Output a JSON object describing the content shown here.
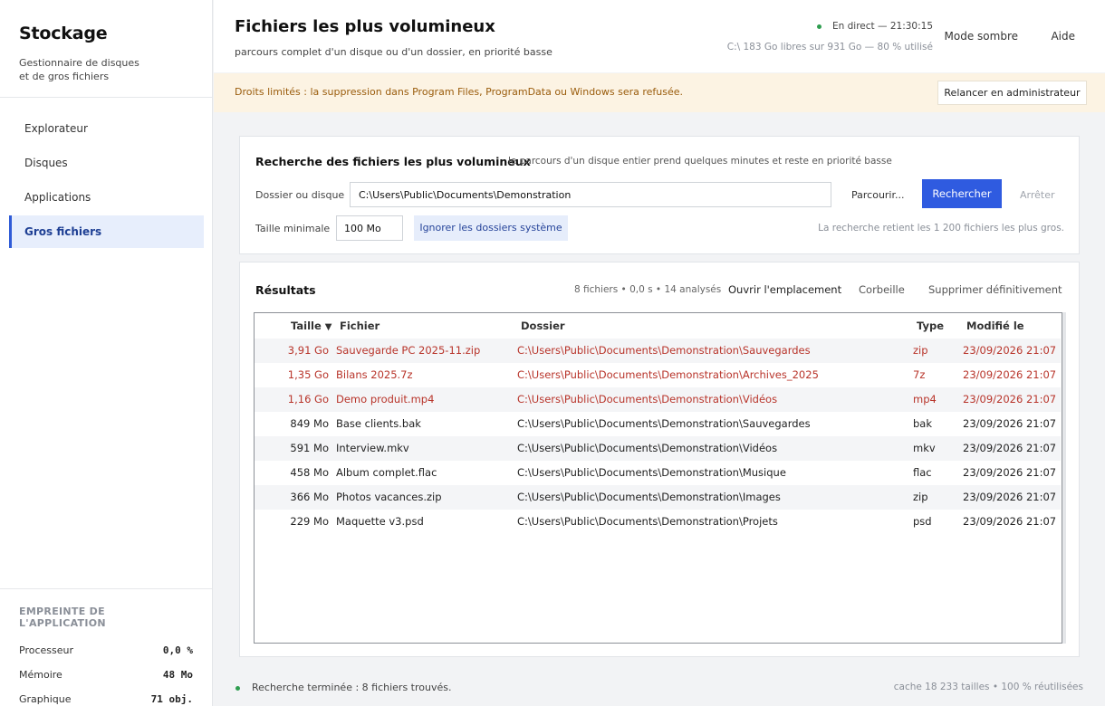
{
  "app": {
    "title": "Stockage",
    "subtitle": "Gestionnaire de disques et de gros fichiers"
  },
  "sidebar": {
    "items": [
      {
        "label": "Explorateur",
        "active": false
      },
      {
        "label": "Disques",
        "active": false
      },
      {
        "label": "Applications",
        "active": false
      },
      {
        "label": "Gros fichiers",
        "active": true
      }
    ],
    "footprint": {
      "title": "EMPREINTE DE L'APPLICATION",
      "rows": [
        {
          "label": "Processeur",
          "value": "0,0 %"
        },
        {
          "label": "Mémoire",
          "value": "48 Mo"
        },
        {
          "label": "Graphique",
          "value": "71 obj."
        }
      ]
    }
  },
  "header": {
    "title": "Fichiers les plus volumineux",
    "subtitle": "parcours complet d'un disque ou d'un dossier, en priorité basse",
    "live": "En direct — 21:30:15",
    "disk_info": "C:\\ 183 Go libres sur 931 Go — 80 % utilisé",
    "dark_mode": "Mode sombre",
    "help": "Aide"
  },
  "banner": {
    "text": "Droits limités : la suppression dans Program Files, ProgramData ou Windows sera refusée.",
    "button": "Relancer en administrateur"
  },
  "search": {
    "title": "Recherche des fichiers les plus volumineux",
    "hint": "le parcours d'un disque entier prend quelques minutes et reste en priorité basse",
    "folder_label": "Dossier ou disque",
    "folder_value": "C:\\Users\\Public\\Documents\\Demonstration",
    "browse": "Parcourir...",
    "search_button": "Rechercher",
    "stop_button": "Arrêter",
    "min_size_label": "Taille minimale",
    "min_size_value": "100 Mo",
    "ignore_system": "Ignorer les dossiers système",
    "limit_note": "La recherche retient les 1 200 fichiers les plus gros."
  },
  "results": {
    "title": "Résultats",
    "stats": "8 fichiers • 0,0 s • 14 analysés",
    "open_location": "Ouvrir l'emplacement",
    "trash": "Corbeille",
    "delete_permanently": "Supprimer définitivement",
    "columns": {
      "size": "Taille",
      "file": "Fichier",
      "folder": "Dossier",
      "type": "Type",
      "modified": "Modifié le"
    },
    "sort_indicator": "▼",
    "highlight_color": "#b8342a",
    "rows": [
      {
        "size": "3,91 Go",
        "file": "Sauvegarde PC 2025-11.zip",
        "folder": "C:\\Users\\Public\\Documents\\Demonstration\\Sauvegardes",
        "type": "zip",
        "modified": "23/09/2026 21:07",
        "highlight": true
      },
      {
        "size": "1,35 Go",
        "file": "Bilans 2025.7z",
        "folder": "C:\\Users\\Public\\Documents\\Demonstration\\Archives_2025",
        "type": "7z",
        "modified": "23/09/2026 21:07",
        "highlight": true
      },
      {
        "size": "1,16 Go",
        "file": "Demo produit.mp4",
        "folder": "C:\\Users\\Public\\Documents\\Demonstration\\Vidéos",
        "type": "mp4",
        "modified": "23/09/2026 21:07",
        "highlight": true
      },
      {
        "size": "849 Mo",
        "file": "Base clients.bak",
        "folder": "C:\\Users\\Public\\Documents\\Demonstration\\Sauvegardes",
        "type": "bak",
        "modified": "23/09/2026 21:07",
        "highlight": false
      },
      {
        "size": "591 Mo",
        "file": "Interview.mkv",
        "folder": "C:\\Users\\Public\\Documents\\Demonstration\\Vidéos",
        "type": "mkv",
        "modified": "23/09/2026 21:07",
        "highlight": false
      },
      {
        "size": "458 Mo",
        "file": "Album complet.flac",
        "folder": "C:\\Users\\Public\\Documents\\Demonstration\\Musique",
        "type": "flac",
        "modified": "23/09/2026 21:07",
        "highlight": false
      },
      {
        "size": "366 Mo",
        "file": "Photos vacances.zip",
        "folder": "C:\\Users\\Public\\Documents\\Demonstration\\Images",
        "type": "zip",
        "modified": "23/09/2026 21:07",
        "highlight": false
      },
      {
        "size": "229 Mo",
        "file": "Maquette v3.psd",
        "folder": "C:\\Users\\Public\\Documents\\Demonstration\\Projets",
        "type": "psd",
        "modified": "23/09/2026 21:07",
        "highlight": false
      }
    ]
  },
  "status": {
    "text": "Recherche terminée : 8 fichiers trouvés.",
    "cache": "cache 18 233 tailles • 100 % réutilisées"
  }
}
